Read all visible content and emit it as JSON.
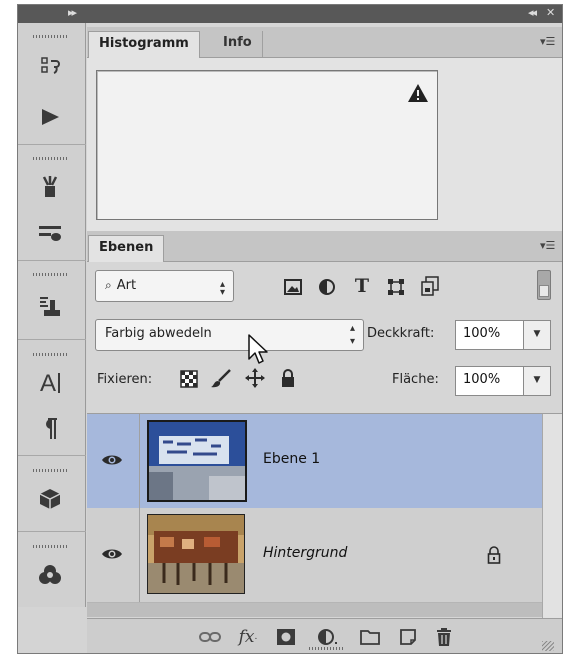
{
  "histogram_panel": {
    "tabs": [
      "Histogramm",
      "Info"
    ],
    "warning_icon": "warning-triangle-icon"
  },
  "layers_panel": {
    "tab": "Ebenen",
    "filter_kind": "Art",
    "blend_mode": "Farbig abwedeln",
    "opacity_label": "Deckkraft:",
    "opacity_value": "100%",
    "lock_label": "Fixieren:",
    "fill_label": "Fläche:",
    "fill_value": "100%",
    "layers": [
      {
        "name": "Ebene 1",
        "selected": true,
        "visible": true,
        "locked": false
      },
      {
        "name": "Hintergrund",
        "selected": false,
        "visible": true,
        "locked": true
      }
    ]
  },
  "colors": {
    "selected_layer": "#a6b8dc",
    "panel_bg": "#d6d6d6",
    "header_bg": "#585858"
  }
}
